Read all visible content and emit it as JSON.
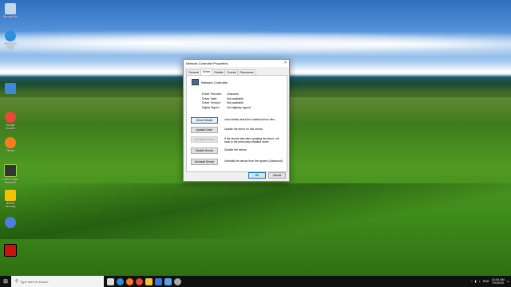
{
  "desktop": {
    "icons": [
      {
        "label": "Recycle Bin",
        "icon": "recycle-bin-icon",
        "color": "#c9d6e6"
      },
      {
        "label": "Microsoft Edge",
        "icon": "edge-icon",
        "color": "#2f8fdc"
      },
      {
        "label": "",
        "icon": "computer-icon",
        "color": "#3a8ad8"
      },
      {
        "label": "Google Chrome",
        "icon": "chrome-icon",
        "color": "#e6493a"
      },
      {
        "label": "Firefox",
        "icon": "firefox-icon",
        "color": "#ff7b1c"
      },
      {
        "label": "Leets Trojan Remover",
        "icon": "remover-icon",
        "color": "#333333"
      },
      {
        "label": "Norton Security",
        "icon": "norton-icon",
        "color": "#f2c200"
      },
      {
        "label": "",
        "icon": "globe-icon",
        "color": "#4a7fe0"
      },
      {
        "label": "",
        "icon": "app-icon",
        "color": "#cc1111"
      }
    ]
  },
  "dialog": {
    "title": "Network Controller Properties",
    "close_symbol": "×",
    "tabs": [
      "General",
      "Driver",
      "Details",
      "Events",
      "Resources"
    ],
    "active_tab": "Driver",
    "device_name": "Network Controller",
    "info": [
      {
        "key": "Driver Provider:",
        "value": "Unknown"
      },
      {
        "key": "Driver Date:",
        "value": "Not available"
      },
      {
        "key": "Driver Version:",
        "value": "Not available"
      },
      {
        "key": "Digital Signer:",
        "value": "Not digitally signed"
      }
    ],
    "actions": [
      {
        "label": "Driver Details",
        "desc": "View details about the installed driver files.",
        "state": "focus"
      },
      {
        "label": "Update Driver",
        "desc": "Update the driver for this device.",
        "state": "normal"
      },
      {
        "label": "Roll Back Driver",
        "desc": "If the device fails after updating the driver, roll back to the previously installed driver.",
        "state": "disabled"
      },
      {
        "label": "Disable Device",
        "desc": "Disable the device.",
        "state": "normal"
      },
      {
        "label": "Uninstall Device",
        "desc": "Uninstall the device from the system (Advanced).",
        "state": "normal"
      }
    ],
    "ok_label": "OK",
    "cancel_label": "Cancel"
  },
  "taskbar": {
    "search_placeholder": "Type here to search",
    "pinned": [
      {
        "icon": "task-view-icon",
        "color": "#dddddd"
      },
      {
        "icon": "edge-icon",
        "color": "#2f8fdc"
      },
      {
        "icon": "firefox-icon",
        "color": "#ff7b1c"
      },
      {
        "icon": "chrome-icon",
        "color": "#e6493a"
      },
      {
        "icon": "file-explorer-icon",
        "color": "#f0c23b"
      },
      {
        "icon": "store-icon",
        "color": "#3b78d8"
      },
      {
        "icon": "mail-icon",
        "color": "#5aa0e8"
      },
      {
        "icon": "settings-icon",
        "color": "#aaaaaa"
      }
    ],
    "language": "ENG",
    "time": "10:XX AM",
    "date": "7/X/20XX"
  }
}
